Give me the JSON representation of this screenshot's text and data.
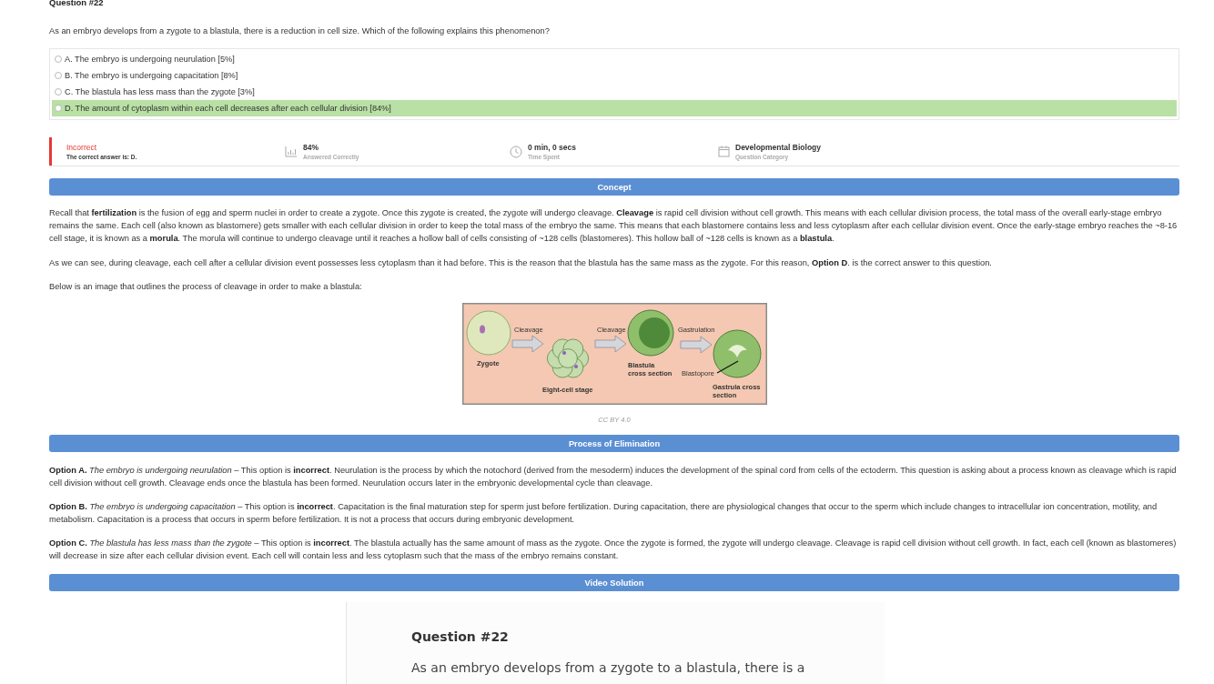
{
  "question": {
    "title": "Question #22",
    "text": "As an embryo develops from a zygote to a blastula, there is a reduction in cell size. Which of the following explains this phenomenon?"
  },
  "options": [
    {
      "label": "A. The embryo is undergoing neurulation [5%]",
      "selected": false,
      "correct": false
    },
    {
      "label": "B. The embryo is undergoing capacitation [8%]",
      "selected": false,
      "correct": false
    },
    {
      "label": "C. The blastula has less mass than the zygote [3%]",
      "selected": false,
      "correct": false
    },
    {
      "label": "D. The amount of cytoplasm within each cell decreases after each cellular division [84%]",
      "selected": false,
      "correct": true
    }
  ],
  "stats": [
    {
      "kind": "result",
      "value": "Incorrect",
      "caption": "The correct answer is: D."
    },
    {
      "kind": "percent",
      "value": "84%",
      "caption": "Answered Correctly"
    },
    {
      "kind": "time",
      "value": "0 min, 0 secs",
      "caption": "Time Spent"
    },
    {
      "kind": "category",
      "value": "Developmental Biology",
      "caption": "Question Category"
    }
  ],
  "concept": {
    "heading": "Concept",
    "paragraphs": [
      "Recall that **fertilization** is the fusion of egg and sperm nuclei in order to create a zygote. Once this zygote is created, the zygote will undergo cleavage. **Cleavage** is rapid cell division without cell growth. This means with each cellular division process, the total mass of the overall early-stage embryo remains the same. Each cell (also known as blastomere) gets smaller with each cellular division in order to keep the total mass of the embryo the same. This means that each blastomere contains less and less cytoplasm after each cellular division event. Once the early-stage embryo reaches the ~8-16 cell stage, it is known as a **morula**. The morula will continue to undergo cleavage until it reaches a hollow ball of cells consisting of ~128 cells (blastomeres). This hollow ball of ~128 cells is known as a **blastula**.",
      "As we can see, during cleavage, each cell after a cellular division event possesses less cytoplasm than it had before. This is the reason that the blastula has the same mass as the zygote. For this reason, **Option D**. is the correct answer to this question.",
      "Below is an image that outlines the process of cleavage in order to make a blastula:"
    ],
    "figure": {
      "labels": [
        "Cleavage",
        "Cleavage",
        "Gastrulation",
        "Zygote",
        "Eight-cell stage",
        "Blastula",
        "cross section",
        "Blastopore",
        "Gastrula cross",
        "section"
      ],
      "credit": "CC BY 4.0"
    }
  },
  "elimination": {
    "heading": "Process of Elimination",
    "paragraphs": [
      "**Option A.** *The embryo is undergoing neurulation* – This option is **incorrect**. Neurulation is the process by which the notochord (derived from the mesoderm) induces the development of the spinal cord from cells of the ectoderm. This question is asking about a process known as cleavage which is rapid cell division without cell growth. Cleavage ends once the blastula has been formed. Neurulation occurs later in the embryonic developmental cycle than cleavage.",
      "**Option B.**  *The embryo is undergoing capacitation* – This option is **incorrect**. Capacitation is the final maturation step for sperm just before fertilization. During capacitation, there are physiological changes that occur to the sperm which include changes to intracellular ion concentration, motility, and metabolism. Capacitation is a process that occurs in sperm before fertilization. It is not a process that occurs during embryonic development.",
      "**Option C.** *The blastula has less mass than the zygote* – This option is **incorrect**. The blastula actually has the same amount of mass as the zygote. Once the zygote is formed, the zygote will undergo cleavage. Cleavage is rapid cell division without cell growth. In fact, each cell (known as blastomeres) will decrease in size after each cellular division event. Each cell will contain less and less cytoplasm such that the mass of the embryo remains constant."
    ]
  },
  "video": {
    "heading": "Video Solution",
    "frame_title": "Question #22",
    "frame_text": "As an embryo develops from a zygote to a blastula, there is a"
  }
}
